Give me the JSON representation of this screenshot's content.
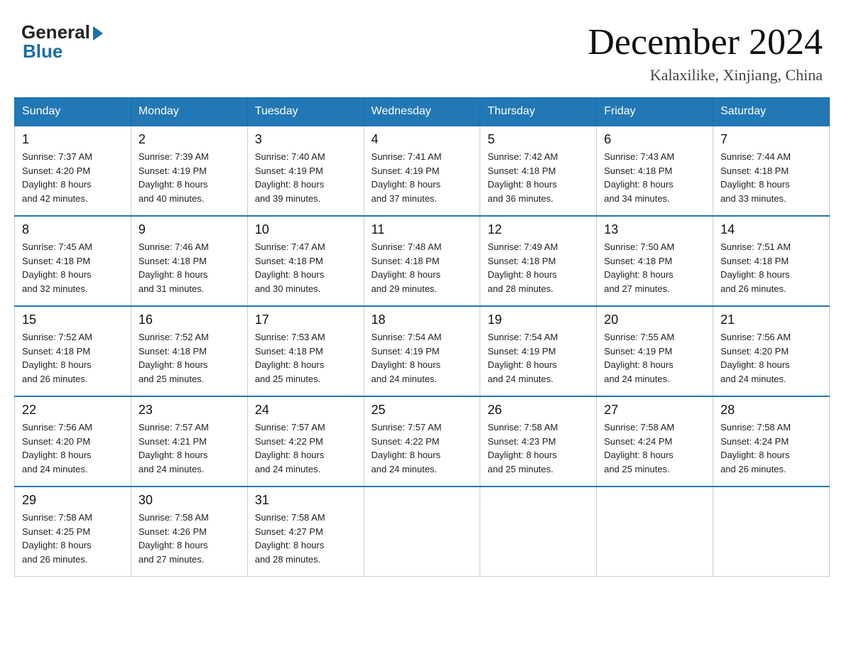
{
  "header": {
    "logo_general": "General",
    "logo_blue": "Blue",
    "month_title": "December 2024",
    "location": "Kalaxilike, Xinjiang, China"
  },
  "days_of_week": [
    "Sunday",
    "Monday",
    "Tuesday",
    "Wednesday",
    "Thursday",
    "Friday",
    "Saturday"
  ],
  "weeks": [
    [
      {
        "day": "1",
        "sunrise": "7:37 AM",
        "sunset": "4:20 PM",
        "daylight": "8 hours and 42 minutes."
      },
      {
        "day": "2",
        "sunrise": "7:39 AM",
        "sunset": "4:19 PM",
        "daylight": "8 hours and 40 minutes."
      },
      {
        "day": "3",
        "sunrise": "7:40 AM",
        "sunset": "4:19 PM",
        "daylight": "8 hours and 39 minutes."
      },
      {
        "day": "4",
        "sunrise": "7:41 AM",
        "sunset": "4:19 PM",
        "daylight": "8 hours and 37 minutes."
      },
      {
        "day": "5",
        "sunrise": "7:42 AM",
        "sunset": "4:18 PM",
        "daylight": "8 hours and 36 minutes."
      },
      {
        "day": "6",
        "sunrise": "7:43 AM",
        "sunset": "4:18 PM",
        "daylight": "8 hours and 34 minutes."
      },
      {
        "day": "7",
        "sunrise": "7:44 AM",
        "sunset": "4:18 PM",
        "daylight": "8 hours and 33 minutes."
      }
    ],
    [
      {
        "day": "8",
        "sunrise": "7:45 AM",
        "sunset": "4:18 PM",
        "daylight": "8 hours and 32 minutes."
      },
      {
        "day": "9",
        "sunrise": "7:46 AM",
        "sunset": "4:18 PM",
        "daylight": "8 hours and 31 minutes."
      },
      {
        "day": "10",
        "sunrise": "7:47 AM",
        "sunset": "4:18 PM",
        "daylight": "8 hours and 30 minutes."
      },
      {
        "day": "11",
        "sunrise": "7:48 AM",
        "sunset": "4:18 PM",
        "daylight": "8 hours and 29 minutes."
      },
      {
        "day": "12",
        "sunrise": "7:49 AM",
        "sunset": "4:18 PM",
        "daylight": "8 hours and 28 minutes."
      },
      {
        "day": "13",
        "sunrise": "7:50 AM",
        "sunset": "4:18 PM",
        "daylight": "8 hours and 27 minutes."
      },
      {
        "day": "14",
        "sunrise": "7:51 AM",
        "sunset": "4:18 PM",
        "daylight": "8 hours and 26 minutes."
      }
    ],
    [
      {
        "day": "15",
        "sunrise": "7:52 AM",
        "sunset": "4:18 PM",
        "daylight": "8 hours and 26 minutes."
      },
      {
        "day": "16",
        "sunrise": "7:52 AM",
        "sunset": "4:18 PM",
        "daylight": "8 hours and 25 minutes."
      },
      {
        "day": "17",
        "sunrise": "7:53 AM",
        "sunset": "4:18 PM",
        "daylight": "8 hours and 25 minutes."
      },
      {
        "day": "18",
        "sunrise": "7:54 AM",
        "sunset": "4:19 PM",
        "daylight": "8 hours and 24 minutes."
      },
      {
        "day": "19",
        "sunrise": "7:54 AM",
        "sunset": "4:19 PM",
        "daylight": "8 hours and 24 minutes."
      },
      {
        "day": "20",
        "sunrise": "7:55 AM",
        "sunset": "4:19 PM",
        "daylight": "8 hours and 24 minutes."
      },
      {
        "day": "21",
        "sunrise": "7:56 AM",
        "sunset": "4:20 PM",
        "daylight": "8 hours and 24 minutes."
      }
    ],
    [
      {
        "day": "22",
        "sunrise": "7:56 AM",
        "sunset": "4:20 PM",
        "daylight": "8 hours and 24 minutes."
      },
      {
        "day": "23",
        "sunrise": "7:57 AM",
        "sunset": "4:21 PM",
        "daylight": "8 hours and 24 minutes."
      },
      {
        "day": "24",
        "sunrise": "7:57 AM",
        "sunset": "4:22 PM",
        "daylight": "8 hours and 24 minutes."
      },
      {
        "day": "25",
        "sunrise": "7:57 AM",
        "sunset": "4:22 PM",
        "daylight": "8 hours and 24 minutes."
      },
      {
        "day": "26",
        "sunrise": "7:58 AM",
        "sunset": "4:23 PM",
        "daylight": "8 hours and 25 minutes."
      },
      {
        "day": "27",
        "sunrise": "7:58 AM",
        "sunset": "4:24 PM",
        "daylight": "8 hours and 25 minutes."
      },
      {
        "day": "28",
        "sunrise": "7:58 AM",
        "sunset": "4:24 PM",
        "daylight": "8 hours and 26 minutes."
      }
    ],
    [
      {
        "day": "29",
        "sunrise": "7:58 AM",
        "sunset": "4:25 PM",
        "daylight": "8 hours and 26 minutes."
      },
      {
        "day": "30",
        "sunrise": "7:58 AM",
        "sunset": "4:26 PM",
        "daylight": "8 hours and 27 minutes."
      },
      {
        "day": "31",
        "sunrise": "7:58 AM",
        "sunset": "4:27 PM",
        "daylight": "8 hours and 28 minutes."
      },
      null,
      null,
      null,
      null
    ]
  ],
  "labels": {
    "sunrise_prefix": "Sunrise: ",
    "sunset_prefix": "Sunset: ",
    "daylight_prefix": "Daylight: "
  }
}
